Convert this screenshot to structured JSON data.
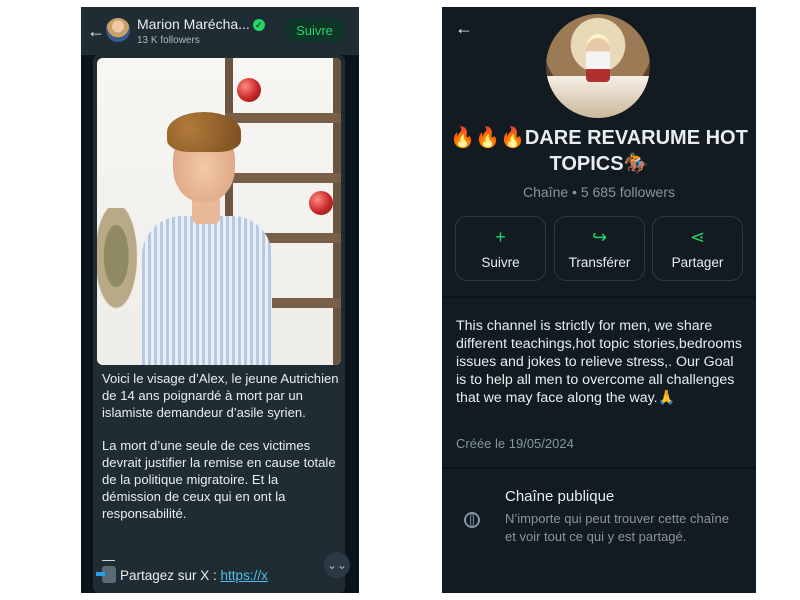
{
  "left": {
    "header": {
      "back_glyph": "←",
      "channel_name": "Marion Maréchа...",
      "verified_glyph": "✓",
      "followers": "13 K followers",
      "follow_label": "Suivre"
    },
    "message": {
      "paragraph_1": "Voici le visage d’Alex, le jeune Autrichien de 14 ans poignardé à mort par un islamiste demandeur d’asile syrien.",
      "paragraph_2": "La mort d’une seule de ces victimes devrait justifier la remise en cause totale de la politique migratoire. Et la démission de ceux qui en ont la responsabilité.",
      "separator": "—",
      "share_prefix": "Partagez sur X : ",
      "share_link": "https://x",
      "scroll_glyph": "⌄⌄"
    }
  },
  "right": {
    "back_glyph": "←",
    "title": "🔥🔥🔥DARE REVARUME HOT TOPICS🏇",
    "subtitle": "Chaîne • 5 685 followers",
    "actions": [
      {
        "label": "Suivre",
        "icon": "+"
      },
      {
        "label": "Transférer",
        "icon": "↪"
      },
      {
        "label": "Partager",
        "icon": "⋖"
      }
    ],
    "description": "This channel is strictly for men, we share different teachings,hot topic stories,bedrooms issues and jokes to relieve stress,. Our Goal is to help all men to overcome all challenges that we may face along the way.🙏",
    "created": "Créée le 19/05/2024",
    "public_title": "Chaîne publique",
    "public_desc": "N’importe qui peut trouver cette chaîne et voir tout ce qui y est partagé."
  },
  "colors": {
    "accent": "#25d366",
    "panel_bg": "#0b141a",
    "bubble_bg": "#1f2c34",
    "link": "#53bdeb"
  }
}
